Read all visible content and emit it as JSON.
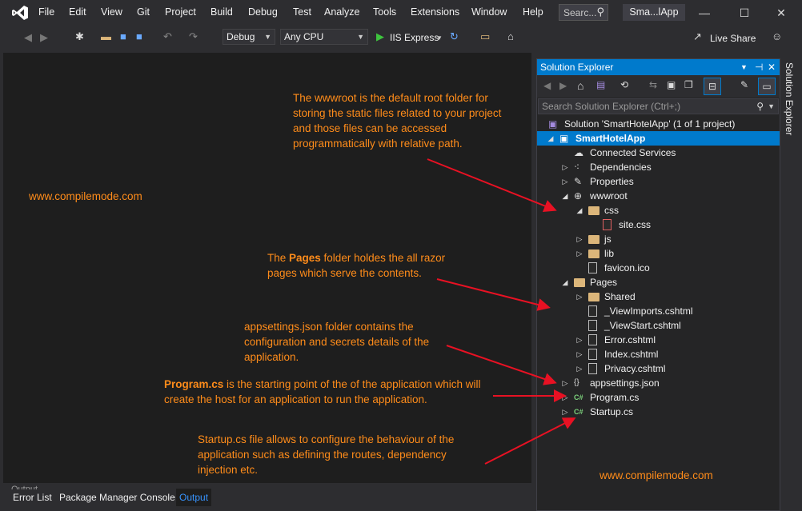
{
  "menu": {
    "items": [
      "File",
      "Edit",
      "View",
      "Git",
      "Project",
      "Build",
      "Debug",
      "Test",
      "Analyze",
      "Tools",
      "Extensions",
      "Window",
      "Help"
    ],
    "search_placeholder": "Searc...",
    "app_title": "Sma...lApp"
  },
  "toolbar": {
    "config": "Debug",
    "platform": "Any CPU",
    "run_target": "IIS Express",
    "live_share": "Live Share"
  },
  "bottom_tabs": [
    "Error List",
    "Package Manager Console",
    "Output"
  ],
  "bottom_panel_title": "Output",
  "solution_explorer": {
    "title": "Solution Explorer",
    "vertical_tab": "Solution Explorer",
    "search_placeholder": "Search Solution Explorer (Ctrl+;)",
    "tree": [
      {
        "label": "Solution 'SmartHotelApp' (1 of 1 project)",
        "icon": "solution-icon",
        "level": 0,
        "expander": ""
      },
      {
        "label": "SmartHotelApp",
        "icon": "web-project-icon",
        "level": 0,
        "expander": "expanded",
        "selected": true
      },
      {
        "label": "Connected Services",
        "icon": "connected-services-icon",
        "level": 1,
        "expander": ""
      },
      {
        "label": "Dependencies",
        "icon": "dependencies-icon",
        "level": 1,
        "expander": "collapsed"
      },
      {
        "label": "Properties",
        "icon": "wrench-icon",
        "level": 1,
        "expander": "collapsed"
      },
      {
        "label": "wwwroot",
        "icon": "globe-icon",
        "level": 1,
        "expander": "expanded"
      },
      {
        "label": "css",
        "icon": "folder-open-icon",
        "level": 2,
        "expander": "expanded"
      },
      {
        "label": "site.css",
        "icon": "css-file-icon",
        "level": 3,
        "expander": ""
      },
      {
        "label": "js",
        "icon": "folder-icon",
        "level": 2,
        "expander": "collapsed"
      },
      {
        "label": "lib",
        "icon": "folder-icon",
        "level": 2,
        "expander": "collapsed"
      },
      {
        "label": "favicon.ico",
        "icon": "file-icon",
        "level": 2,
        "expander": ""
      },
      {
        "label": "Pages",
        "icon": "folder-open-icon",
        "level": 1,
        "expander": "expanded"
      },
      {
        "label": "Shared",
        "icon": "folder-icon",
        "level": 2,
        "expander": "collapsed"
      },
      {
        "label": "_ViewImports.cshtml",
        "icon": "razor-file-icon",
        "level": 2,
        "expander": ""
      },
      {
        "label": "_ViewStart.cshtml",
        "icon": "razor-file-icon",
        "level": 2,
        "expander": ""
      },
      {
        "label": "Error.cshtml",
        "icon": "razor-file-icon",
        "level": 2,
        "expander": "collapsed"
      },
      {
        "label": "Index.cshtml",
        "icon": "razor-file-icon",
        "level": 2,
        "expander": "collapsed"
      },
      {
        "label": "Privacy.cshtml",
        "icon": "razor-file-icon",
        "level": 2,
        "expander": "collapsed"
      },
      {
        "label": "appsettings.json",
        "icon": "json-file-icon",
        "level": 1,
        "expander": "collapsed"
      },
      {
        "label": "Program.cs",
        "icon": "csharp-file-icon",
        "level": 1,
        "expander": "collapsed"
      },
      {
        "label": "Startup.cs",
        "icon": "csharp-file-icon",
        "level": 1,
        "expander": "collapsed"
      }
    ]
  },
  "annotations": {
    "wwwroot_note": "The wwwroot is the default root folder for storing the static files related to your project and those files can be accessed programmatically with relative path.",
    "pages_note_bold": "Pages",
    "pages_note_pre": "The ",
    "pages_note_post": " folder holdes the all razor pages which serve the contents.",
    "appsettings_note": "appsettings.json folder contains the configuration and secrets details of the application.",
    "program_note_bold": "Program.cs",
    "program_note_post": " is the starting point of the of the application which will create the host for an application to run the application.",
    "startup_note": "Startup.cs file allows to configure the behaviour of the application such as defining the routes, dependency injection etc.",
    "watermark": "www.compilemode.com"
  },
  "colors": {
    "accent": "#007acc",
    "annotation": "#ff8c1a",
    "arrow": "#e81123"
  }
}
